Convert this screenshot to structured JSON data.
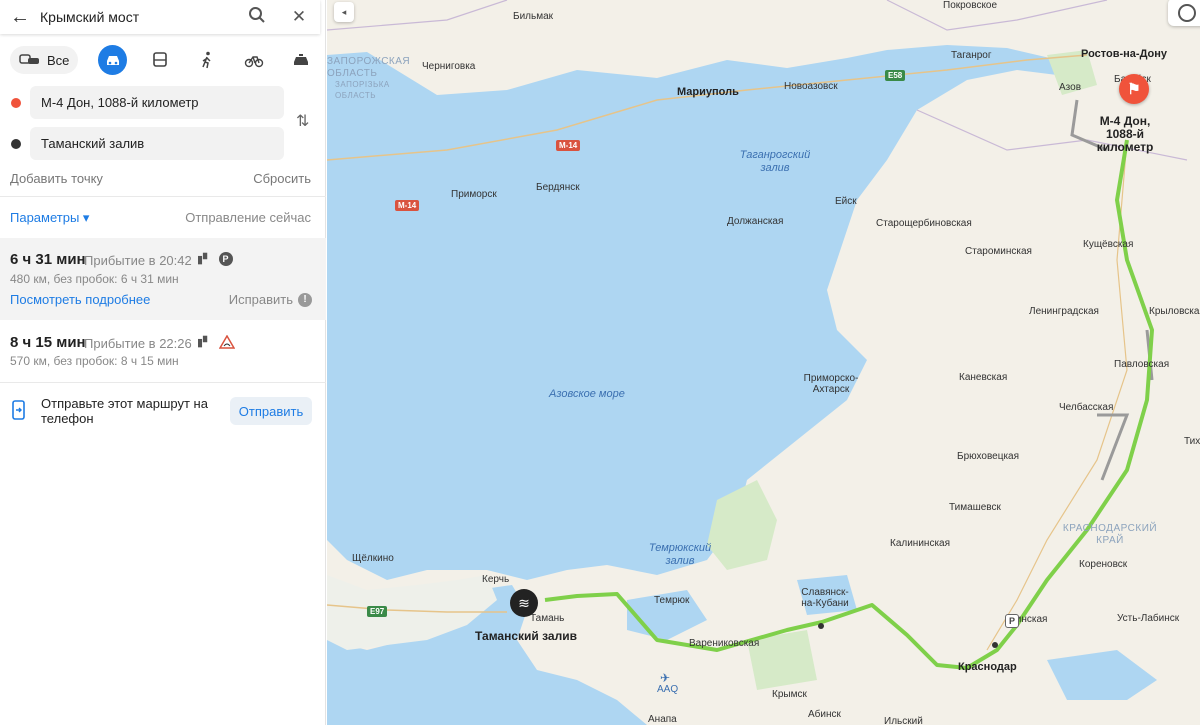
{
  "search": {
    "query": "Крымский мост"
  },
  "modes": {
    "all_label": "Все"
  },
  "points": {
    "from": "М-4 Дон, 1088-й километр",
    "to": "Таманский залив"
  },
  "add_point": "Добавить точку",
  "reset": "Сбросить",
  "params": "Параметры ▾",
  "departure": "Отправление сейчас",
  "routes": [
    {
      "time": "6 ч 31 мин",
      "arrival": "Прибытие в 20:42",
      "details": "480 км, без пробок: 6 ч 31 мин",
      "more": "Посмотреть подробнее",
      "fix": "Исправить"
    },
    {
      "time": "8 ч 15 мин",
      "arrival": "Прибытие в 22:26",
      "details": "570 км, без пробок: 8 ч 15 мин"
    }
  ],
  "send": {
    "text": "Отправьте этот маршрут на телефон",
    "button": "Отправить"
  },
  "colors": {
    "accent": "#1e7ce4",
    "route": "#7fd04a",
    "sea": "#aed6f2",
    "start_dot": "#f0533b",
    "end_dot": "#333333"
  },
  "map": {
    "labels": {
      "bilmak": "Бильмак",
      "pokrovskoe": "Покровское",
      "zaporozh": "ЗАПОРОЖСКАЯ ОБЛАСТЬ",
      "zaporizka": "ЗАПОРІЗЬКА ОБЛАСТЬ",
      "chernigovka": "Черниговка",
      "taganrog": "Таганрог",
      "rostov": "Ростов-на-Дону",
      "bataysk": "Батайск",
      "azov": "Азов",
      "mariupol": "Мариуполь",
      "novoazovsk": "Новоазовск",
      "taganrog_bay": "Таганрогский залив",
      "primorsk": "Приморск",
      "berdyansk": "Бердянск",
      "yeysk": "Ейск",
      "dolzhanskaya": "Должанская",
      "starosherb": "Старощербиновская",
      "kushchevskaya": "Кущёвская",
      "starominskaya": "Староминская",
      "leningradskaya": "Ленинградская",
      "krylovskaya": "Крыловская",
      "pavlovskaya": "Павловская",
      "kanevskaya": "Каневская",
      "primorsko": "Приморско-Ахтарск",
      "azov_sea": "Азовское море",
      "chelbasskaya": "Челбасская",
      "tikh": "Тих",
      "bryukhovetskaya": "Брюховецкая",
      "timashevsk": "Тимашевск",
      "krasnodar_krai": "КРАСНОДАРСКИЙ КРАЙ",
      "kalininskaya": "Калининская",
      "korenovsk": "Кореновск",
      "temryuk_bay": "Темрюкский залив",
      "shchelkino": "Щёлкино",
      "kerch": "Керчь",
      "temryuk": "Темрюк",
      "slavyansk": "Славянск-на-Кубани",
      "taman": "Тамань",
      "taman_bay": "Таманский залив",
      "varenikovskaya": "Варениковская",
      "dinskaya": "Динская",
      "ust_labinsk": "Усть-Лабинск",
      "krasnodar": "Краснодар",
      "krymsk": "Крымск",
      "abinsk": "Абинск",
      "ilskiy": "Ильский",
      "anapa": "Анапа",
      "m4_label": "М-4 Дон, 1088-й километр",
      "airport": "AAQ"
    },
    "shields": {
      "e58": "E58",
      "m14a": "M-14",
      "m14b": "M-14",
      "e97": "E97"
    }
  }
}
